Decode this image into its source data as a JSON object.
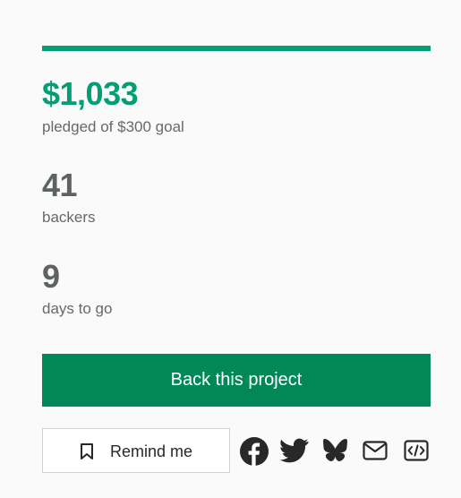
{
  "progress": {
    "percent_funded": 100,
    "color": "#029e74"
  },
  "stats": {
    "pledged_amount": "$1,033",
    "pledged_label": "pledged of $300 goal",
    "backers_count": "41",
    "backers_label": "backers",
    "days_count": "9",
    "days_label": "days to go"
  },
  "actions": {
    "back_label": "Back this project",
    "remind_label": "Remind me"
  },
  "share_icons": [
    "facebook-icon",
    "twitter-icon",
    "bluesky-icon",
    "email-icon",
    "embed-icon"
  ],
  "colors": {
    "accent_green": "#029e74",
    "button_green": "#028858",
    "text_gray": "#656969",
    "icon_dark": "#282828"
  }
}
